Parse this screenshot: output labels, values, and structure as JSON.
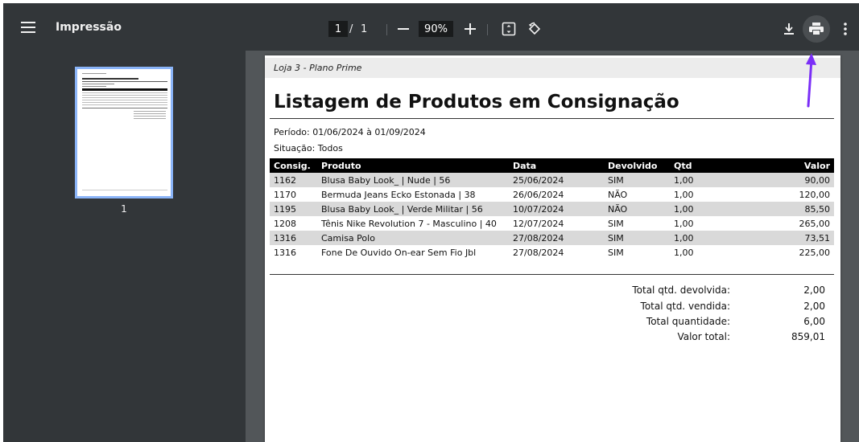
{
  "toolbar": {
    "title": "Impressão",
    "current_page": "1",
    "page_separator": "/",
    "total_pages": "1",
    "zoom": "90%"
  },
  "sidebar": {
    "thumbnail_label": "1"
  },
  "document": {
    "store": "Loja 3 - Plano Prime",
    "title": "Listagem de Produtos em Consignação",
    "period": "Período: 01/06/2024 à 01/09/2024",
    "status": "Situação: Todos",
    "columns": [
      "Consig.",
      "Produto",
      "Data",
      "Devolvido",
      "Qtd",
      "Valor"
    ],
    "rows": [
      [
        "1162",
        "Blusa Baby Look_ | Nude | 56",
        "25/06/2024",
        "SIM",
        "1,00",
        "90,00"
      ],
      [
        "1170",
        "Bermuda Jeans Ecko Estonada | 38",
        "26/06/2024",
        "NÃO",
        "1,00",
        "120,00"
      ],
      [
        "1195",
        "Blusa Baby Look_ | Verde Militar | 56",
        "10/07/2024",
        "NÃO",
        "1,00",
        "85,50"
      ],
      [
        "1208",
        "Tênis Nike Revolution 7 - Masculino | 40",
        "12/07/2024",
        "SIM",
        "1,00",
        "265,00"
      ],
      [
        "1316",
        "Camisa Polo",
        "27/08/2024",
        "SIM",
        "1,00",
        "73,51"
      ],
      [
        "1316",
        "Fone De Ouvido On-ear Sem Fio Jbl",
        "27/08/2024",
        "SIM",
        "1,00",
        "225,00"
      ]
    ],
    "totals": [
      {
        "label": "Total qtd. devolvida:",
        "value": "2,00"
      },
      {
        "label": "Total qtd. vendida:",
        "value": "2,00"
      },
      {
        "label": "Total quantidade:",
        "value": "6,00"
      },
      {
        "label": "Valor total:",
        "value": "859,01"
      }
    ]
  },
  "icons": {
    "menu": "menu-icon",
    "zoom_out": "minus-icon",
    "zoom_in": "plus-icon",
    "fit": "fit-to-page-icon",
    "rotate": "rotate-icon",
    "download": "download-icon",
    "print": "print-icon",
    "more": "more-vertical-icon"
  },
  "colors": {
    "toolbar_bg": "#323639",
    "viewer_bg": "#525659",
    "thumbnail_border": "#8ab4f8",
    "annotation_arrow": "#7b2ff7",
    "table_header_bg": "#000000",
    "table_row_alt": "#d9d9d9"
  }
}
